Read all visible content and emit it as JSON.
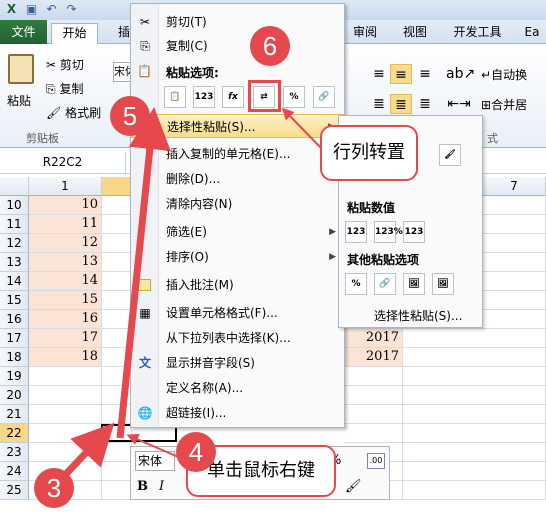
{
  "titlebar": {
    "icons": [
      "excel-icon",
      "save-icon",
      "undo-icon",
      "redo-icon"
    ]
  },
  "tabs": {
    "file": "文件",
    "home": "开始",
    "insert": "插",
    "review": "审阅",
    "view": "视图",
    "developer": "开发工具",
    "more": "Ea"
  },
  "ribbon": {
    "paste": "粘贴",
    "cut": "剪切",
    "copy": "复制",
    "format_painter": "格式刷",
    "clipboard_group": "剪贴板",
    "font_box": "宋体",
    "auto_wrap": "自动换",
    "merge_center": "合并居",
    "align_group_tail": "式"
  },
  "namebox": {
    "value": "R22C2"
  },
  "columns": [
    "1",
    "7"
  ],
  "rows": [
    {
      "num": "10",
      "a": "10",
      "b": ""
    },
    {
      "num": "11",
      "a": "11",
      "b": ""
    },
    {
      "num": "12",
      "a": "12",
      "b": ""
    },
    {
      "num": "13",
      "a": "13",
      "b": ""
    },
    {
      "num": "14",
      "a": "14",
      "b": ""
    },
    {
      "num": "15",
      "a": "15",
      "b": ""
    },
    {
      "num": "16",
      "a": "16",
      "b": ""
    },
    {
      "num": "17",
      "a": "17",
      "b": "2017"
    },
    {
      "num": "18",
      "a": "18",
      "b": "2017"
    },
    {
      "num": "19",
      "a": "",
      "b": ""
    },
    {
      "num": "20",
      "a": "",
      "b": ""
    },
    {
      "num": "21",
      "a": "",
      "b": ""
    },
    {
      "num": "22",
      "a": "",
      "b": ""
    },
    {
      "num": "23",
      "a": "",
      "b": ""
    },
    {
      "num": "24",
      "a": "",
      "b": ""
    },
    {
      "num": "25",
      "a": "",
      "b": ""
    }
  ],
  "context_menu": {
    "cut": "剪切(T)",
    "copy": "复制(C)",
    "paste_options": "粘贴选项:",
    "paste_buttons": [
      "📋",
      "123",
      "fx",
      "⇄",
      "%",
      "🔗"
    ],
    "paste_special": "选择性粘贴(S)...",
    "insert_copied": "插入复制的单元格(E)...",
    "delete": "删除(D)...",
    "clear": "清除内容(N)",
    "filter": "筛选(E)",
    "sort": "排序(O)",
    "insert_comment": "插入批注(M)",
    "format_cells": "设置单元格格式(F)...",
    "pick_list": "从下拉列表中选择(K)...",
    "phonetic": "显示拼音字段(S)",
    "define_name": "定义名称(A)...",
    "hyperlink": "超链接(I)..."
  },
  "submenu": {
    "paste_values": "粘贴数值",
    "other_paste": "其他粘贴选项",
    "paste_special": "选择性粘贴(S)...",
    "value_buttons": [
      "123",
      "123%",
      "123"
    ],
    "other_buttons": [
      "%",
      "🔗",
      "🖼",
      "🖼"
    ]
  },
  "mini_toolbar": {
    "font": "宋体",
    "bold": "B",
    "italic": "I",
    "percent": "%"
  },
  "annotations": {
    "step3": "3",
    "step4": "4",
    "step5": "5",
    "step6": "6",
    "callout_transpose": "行列转置",
    "callout_rightclick": "单击鼠标右键"
  },
  "colors": {
    "accent": "#e5484d",
    "highlight": "#f8dc8c",
    "cell_fill": "#fbe4d5"
  }
}
